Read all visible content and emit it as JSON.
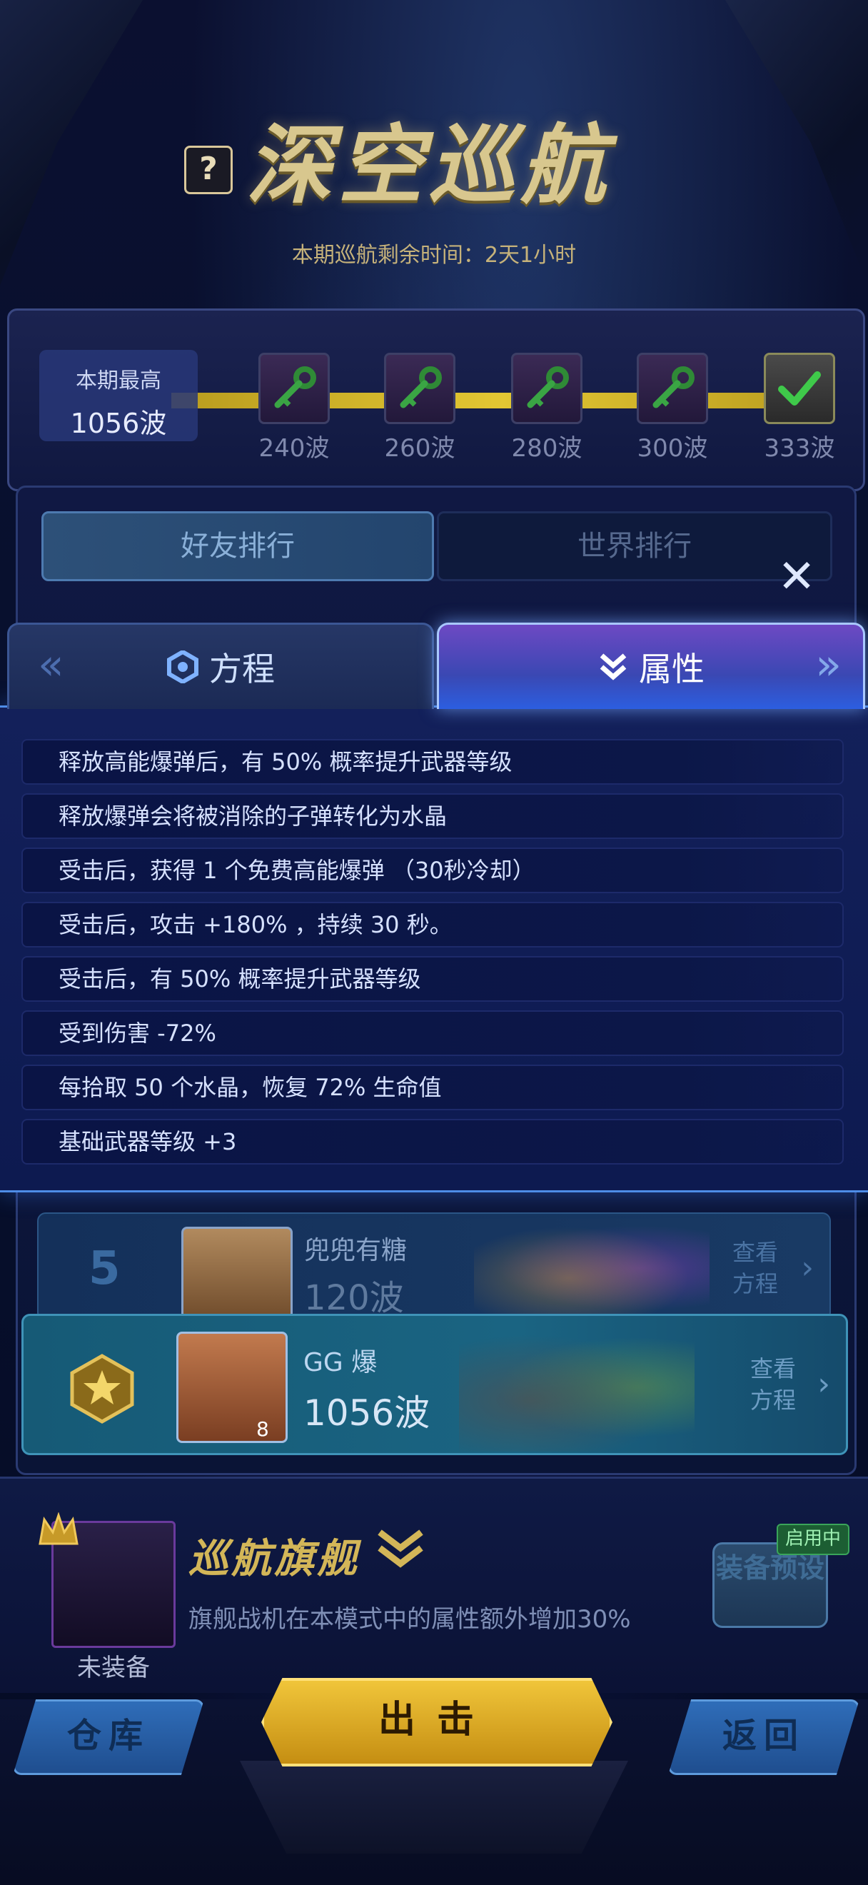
{
  "header": {
    "help": "?",
    "title": "深空巡航",
    "remaining_time": "本期巡航剩余时间：2天1小时"
  },
  "progress": {
    "best_label": "本期最高",
    "best_value": "1056波",
    "milestones": [
      {
        "label": "240波",
        "state": "locked"
      },
      {
        "label": "260波",
        "state": "locked"
      },
      {
        "label": "280波",
        "state": "locked"
      },
      {
        "label": "300波",
        "state": "locked"
      },
      {
        "label": "333波",
        "state": "done"
      }
    ]
  },
  "ranking": {
    "tab_friends": "好友排行",
    "tab_world": "世界排行",
    "row5": {
      "rank": "5",
      "name": "兜兜有糖",
      "waves": "120波",
      "view": "查看方程"
    },
    "self": {
      "name": "GG 爆",
      "waves": "1056波",
      "view": "查看方程",
      "level": "8"
    }
  },
  "popup": {
    "close": "✕",
    "tab_formula": "方程",
    "tab_attributes": "属性",
    "attributes": [
      "释放高能爆弹后，有 50% 概率提升武器等级",
      "释放爆弹会将被消除的子弹转化为水晶",
      "受击后，获得 1 个免费高能爆弹 （30秒冷却）",
      "受击后，攻击 +180% ，持续 30 秒。",
      "受击后，有 50% 概率提升武器等级",
      "受到伤害 -72%",
      "每拾取 50 个水晶，恢复 72% 生命值",
      "基础武器等级 +3"
    ]
  },
  "flagship": {
    "title": "巡航旗舰",
    "description": "旗舰战机在本模式中的属性额外增加30%",
    "status": "未装备",
    "preset_button": "装备预设",
    "enabled_badge": "启用中"
  },
  "bottom": {
    "warehouse": "仓库",
    "attack": "出击",
    "back": "返回"
  },
  "colors": {
    "accent_gold": "#d8c78e",
    "accent_blue": "#4e8de8",
    "active_tab": "#6d49c3"
  }
}
